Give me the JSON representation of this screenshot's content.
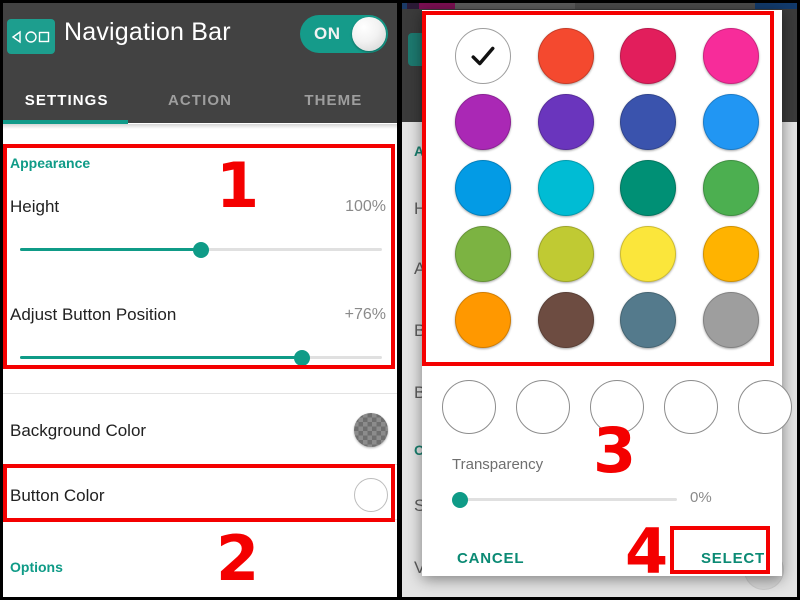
{
  "left": {
    "appbar": {
      "title": "Navigation Bar",
      "nav_icon": "navigation-bar-icon",
      "toggle_label": "ON",
      "toggle_state": "on"
    },
    "tabs": [
      {
        "label": "SETTINGS",
        "active": true
      },
      {
        "label": "ACTION",
        "active": false
      },
      {
        "label": "THEME",
        "active": false
      }
    ],
    "sections": [
      {
        "label": "Appearance",
        "rows": [
          {
            "label": "Height",
            "value": "100%",
            "slider_percent": 50
          },
          {
            "label": "Adjust Button Position",
            "value": "+76%",
            "slider_percent": 78
          }
        ]
      }
    ],
    "color_rows": [
      {
        "label": "Background Color",
        "swatch": "checkerboard"
      },
      {
        "label": "Button Color",
        "swatch": "white"
      }
    ],
    "options_label": "Options"
  },
  "right": {
    "background_items": [
      {
        "label": "Appearance",
        "accent": true
      },
      {
        "label": "Height"
      },
      {
        "label": "Adjust Button Position"
      },
      {
        "label": "Background Color"
      },
      {
        "label": "Button Color"
      },
      {
        "label": "Options",
        "accent": true
      },
      {
        "label": "Show Navigation Bar"
      },
      {
        "label": "Vibrate on Touch"
      }
    ],
    "dialog": {
      "selected_index": 0,
      "colors": [
        {
          "name": "white-selected",
          "hex": "#FFFFFF",
          "selected": true
        },
        {
          "name": "red",
          "hex": "#F4492F",
          "selected": false
        },
        {
          "name": "crimson",
          "hex": "#E21E5C",
          "selected": false
        },
        {
          "name": "hot-pink",
          "hex": "#F72C9A",
          "selected": false
        },
        {
          "name": "magenta",
          "hex": "#AA28B5",
          "selected": false
        },
        {
          "name": "violet",
          "hex": "#6A35BD",
          "selected": false
        },
        {
          "name": "indigo",
          "hex": "#3A53AD",
          "selected": false
        },
        {
          "name": "blue",
          "hex": "#2196F3",
          "selected": false
        },
        {
          "name": "sky-blue",
          "hex": "#039BE5",
          "selected": false
        },
        {
          "name": "cyan",
          "hex": "#00BCD4",
          "selected": false
        },
        {
          "name": "teal",
          "hex": "#009075",
          "selected": false
        },
        {
          "name": "green",
          "hex": "#4CAF50",
          "selected": false
        },
        {
          "name": "light-green",
          "hex": "#7CB342",
          "selected": false
        },
        {
          "name": "lime",
          "hex": "#C0CA33",
          "selected": false
        },
        {
          "name": "yellow",
          "hex": "#FBE63B",
          "selected": false
        },
        {
          "name": "amber",
          "hex": "#FFB300",
          "selected": false
        },
        {
          "name": "orange",
          "hex": "#FF9800",
          "selected": false
        },
        {
          "name": "brown",
          "hex": "#6D4C41",
          "selected": false
        },
        {
          "name": "blue-grey",
          "hex": "#547A8C",
          "selected": false
        },
        {
          "name": "grey",
          "hex": "#9E9E9E",
          "selected": false
        }
      ],
      "alpha_swatch_count": 5,
      "transparency_label": "Transparency",
      "transparency_value": "0%",
      "transparency_percent": 0,
      "cancel_label": "CANCEL",
      "select_label": "SELECT"
    }
  },
  "annotations": [
    {
      "number": "1",
      "target": "appearance-section"
    },
    {
      "number": "2",
      "target": "button-color-row"
    },
    {
      "number": "3",
      "target": "color-grid"
    },
    {
      "number": "4",
      "target": "select-button"
    }
  ],
  "colors": {
    "accent_teal": "#0F9B87",
    "appbar_grey": "#424242",
    "annotation_red": "#F40000"
  }
}
